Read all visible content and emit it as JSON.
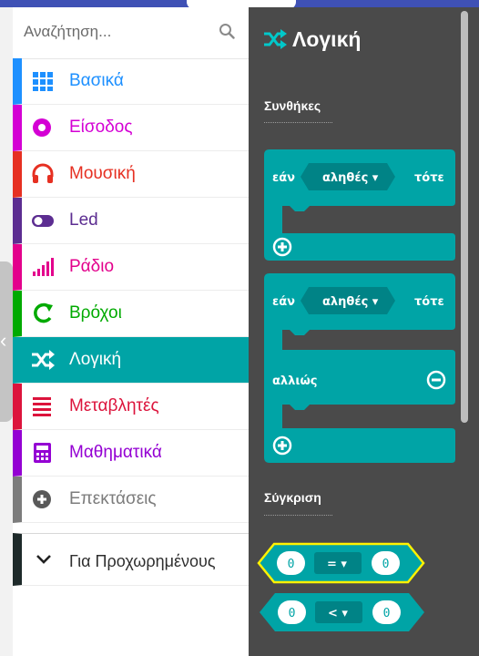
{
  "search": {
    "placeholder": "Αναζήτηση..."
  },
  "categories": [
    {
      "label": "Βασικά",
      "color": "#1e90ff",
      "icon": "grid-icon"
    },
    {
      "label": "Είσοδος",
      "color": "#d400d4",
      "icon": "input-dot-icon"
    },
    {
      "label": "Μουσική",
      "color": "#e63022",
      "icon": "headphones-icon"
    },
    {
      "label": "Led",
      "color": "#5c2d91",
      "icon": "toggle-icon"
    },
    {
      "label": "Ράδιο",
      "color": "#e3008c",
      "icon": "signal-bars-icon"
    },
    {
      "label": "Βρόχοι",
      "color": "#00aa00",
      "icon": "refresh-icon"
    },
    {
      "label": "Λογική",
      "color": "#00a4a6",
      "icon": "shuffle-icon",
      "selected": true
    },
    {
      "label": "Μεταβλητές",
      "color": "#dc143c",
      "icon": "list-lines-icon"
    },
    {
      "label": "Μαθηματικά",
      "color": "#9400d3",
      "icon": "calculator-icon"
    },
    {
      "label": "Επεκτάσεις",
      "color": "#7c7c7c",
      "icon": "plus-circle-icon"
    }
  ],
  "advanced": {
    "label": "Για Προχωρημένους",
    "icon": "chevron-down-icon",
    "color": "#1e2a2a"
  },
  "flyout": {
    "title": "Λογική",
    "section_conditions": "Συνθήκες",
    "section_comparison": "Σύγκριση",
    "if_block": {
      "if": "εάν",
      "cond": "αληθές ▾",
      "then": "τότε"
    },
    "if_else_block": {
      "if": "εάν",
      "cond": "αληθές ▾",
      "then": "τότε",
      "else": "αλλιώς"
    },
    "compare_eq": {
      "left": "0",
      "op": "= ▾",
      "right": "0"
    },
    "compare_lt": {
      "left": "0",
      "op": "< ▾",
      "right": "0"
    }
  },
  "colors": {
    "logic": "#00a4a6",
    "logic_dark": "#008386",
    "flyout_bg": "#4a4a4a",
    "highlight": "#fff200"
  }
}
